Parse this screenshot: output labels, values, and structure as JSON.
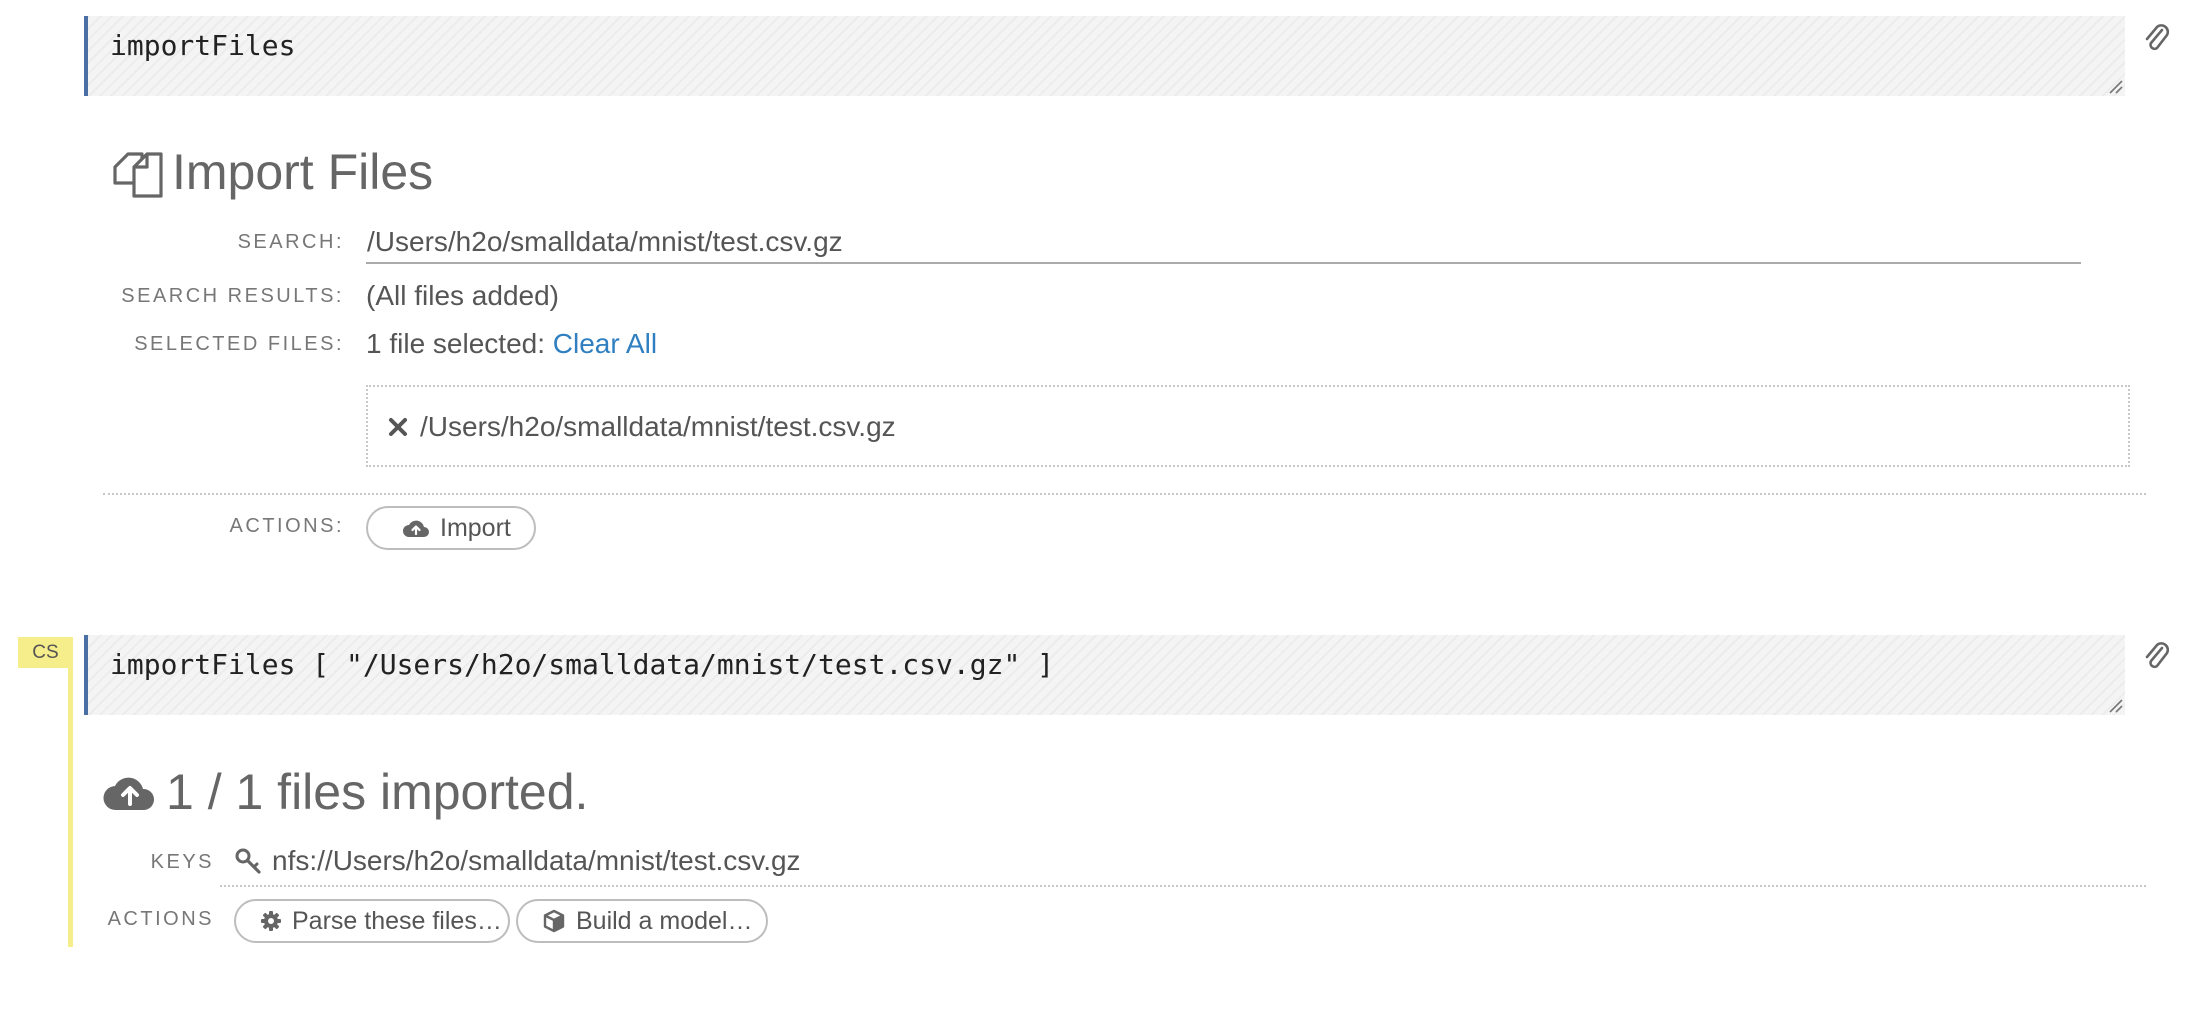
{
  "cell1": {
    "code": "importFiles",
    "title": "Import Files",
    "search": {
      "label": "SEARCH:",
      "value": "/Users/h2o/smalldata/mnist/test.csv.gz"
    },
    "results": {
      "label": "SEARCH RESULTS:",
      "value": "(All files added)"
    },
    "selected": {
      "label": "SELECTED FILES:",
      "text": "1 file selected:",
      "clear_label": "Clear All"
    },
    "files": [
      "/Users/h2o/smalldata/mnist/test.csv.gz"
    ],
    "actions": {
      "label": "ACTIONS:",
      "import_label": "Import"
    }
  },
  "cell2": {
    "tag": "CS",
    "code": "importFiles [ \"/Users/h2o/smalldata/mnist/test.csv.gz\" ]",
    "title": "1 / 1 files imported.",
    "keys": {
      "label": "KEYS",
      "value": "nfs://Users/h2o/smalldata/mnist/test.csv.gz"
    },
    "actions": {
      "label": "ACTIONS",
      "parse_label": "Parse these files…",
      "build_label": "Build a model…"
    }
  },
  "colors": {
    "accent": "#2f7fc1",
    "cell_border": "#4a6fa5",
    "cs_tag": "#f6ed8b"
  }
}
